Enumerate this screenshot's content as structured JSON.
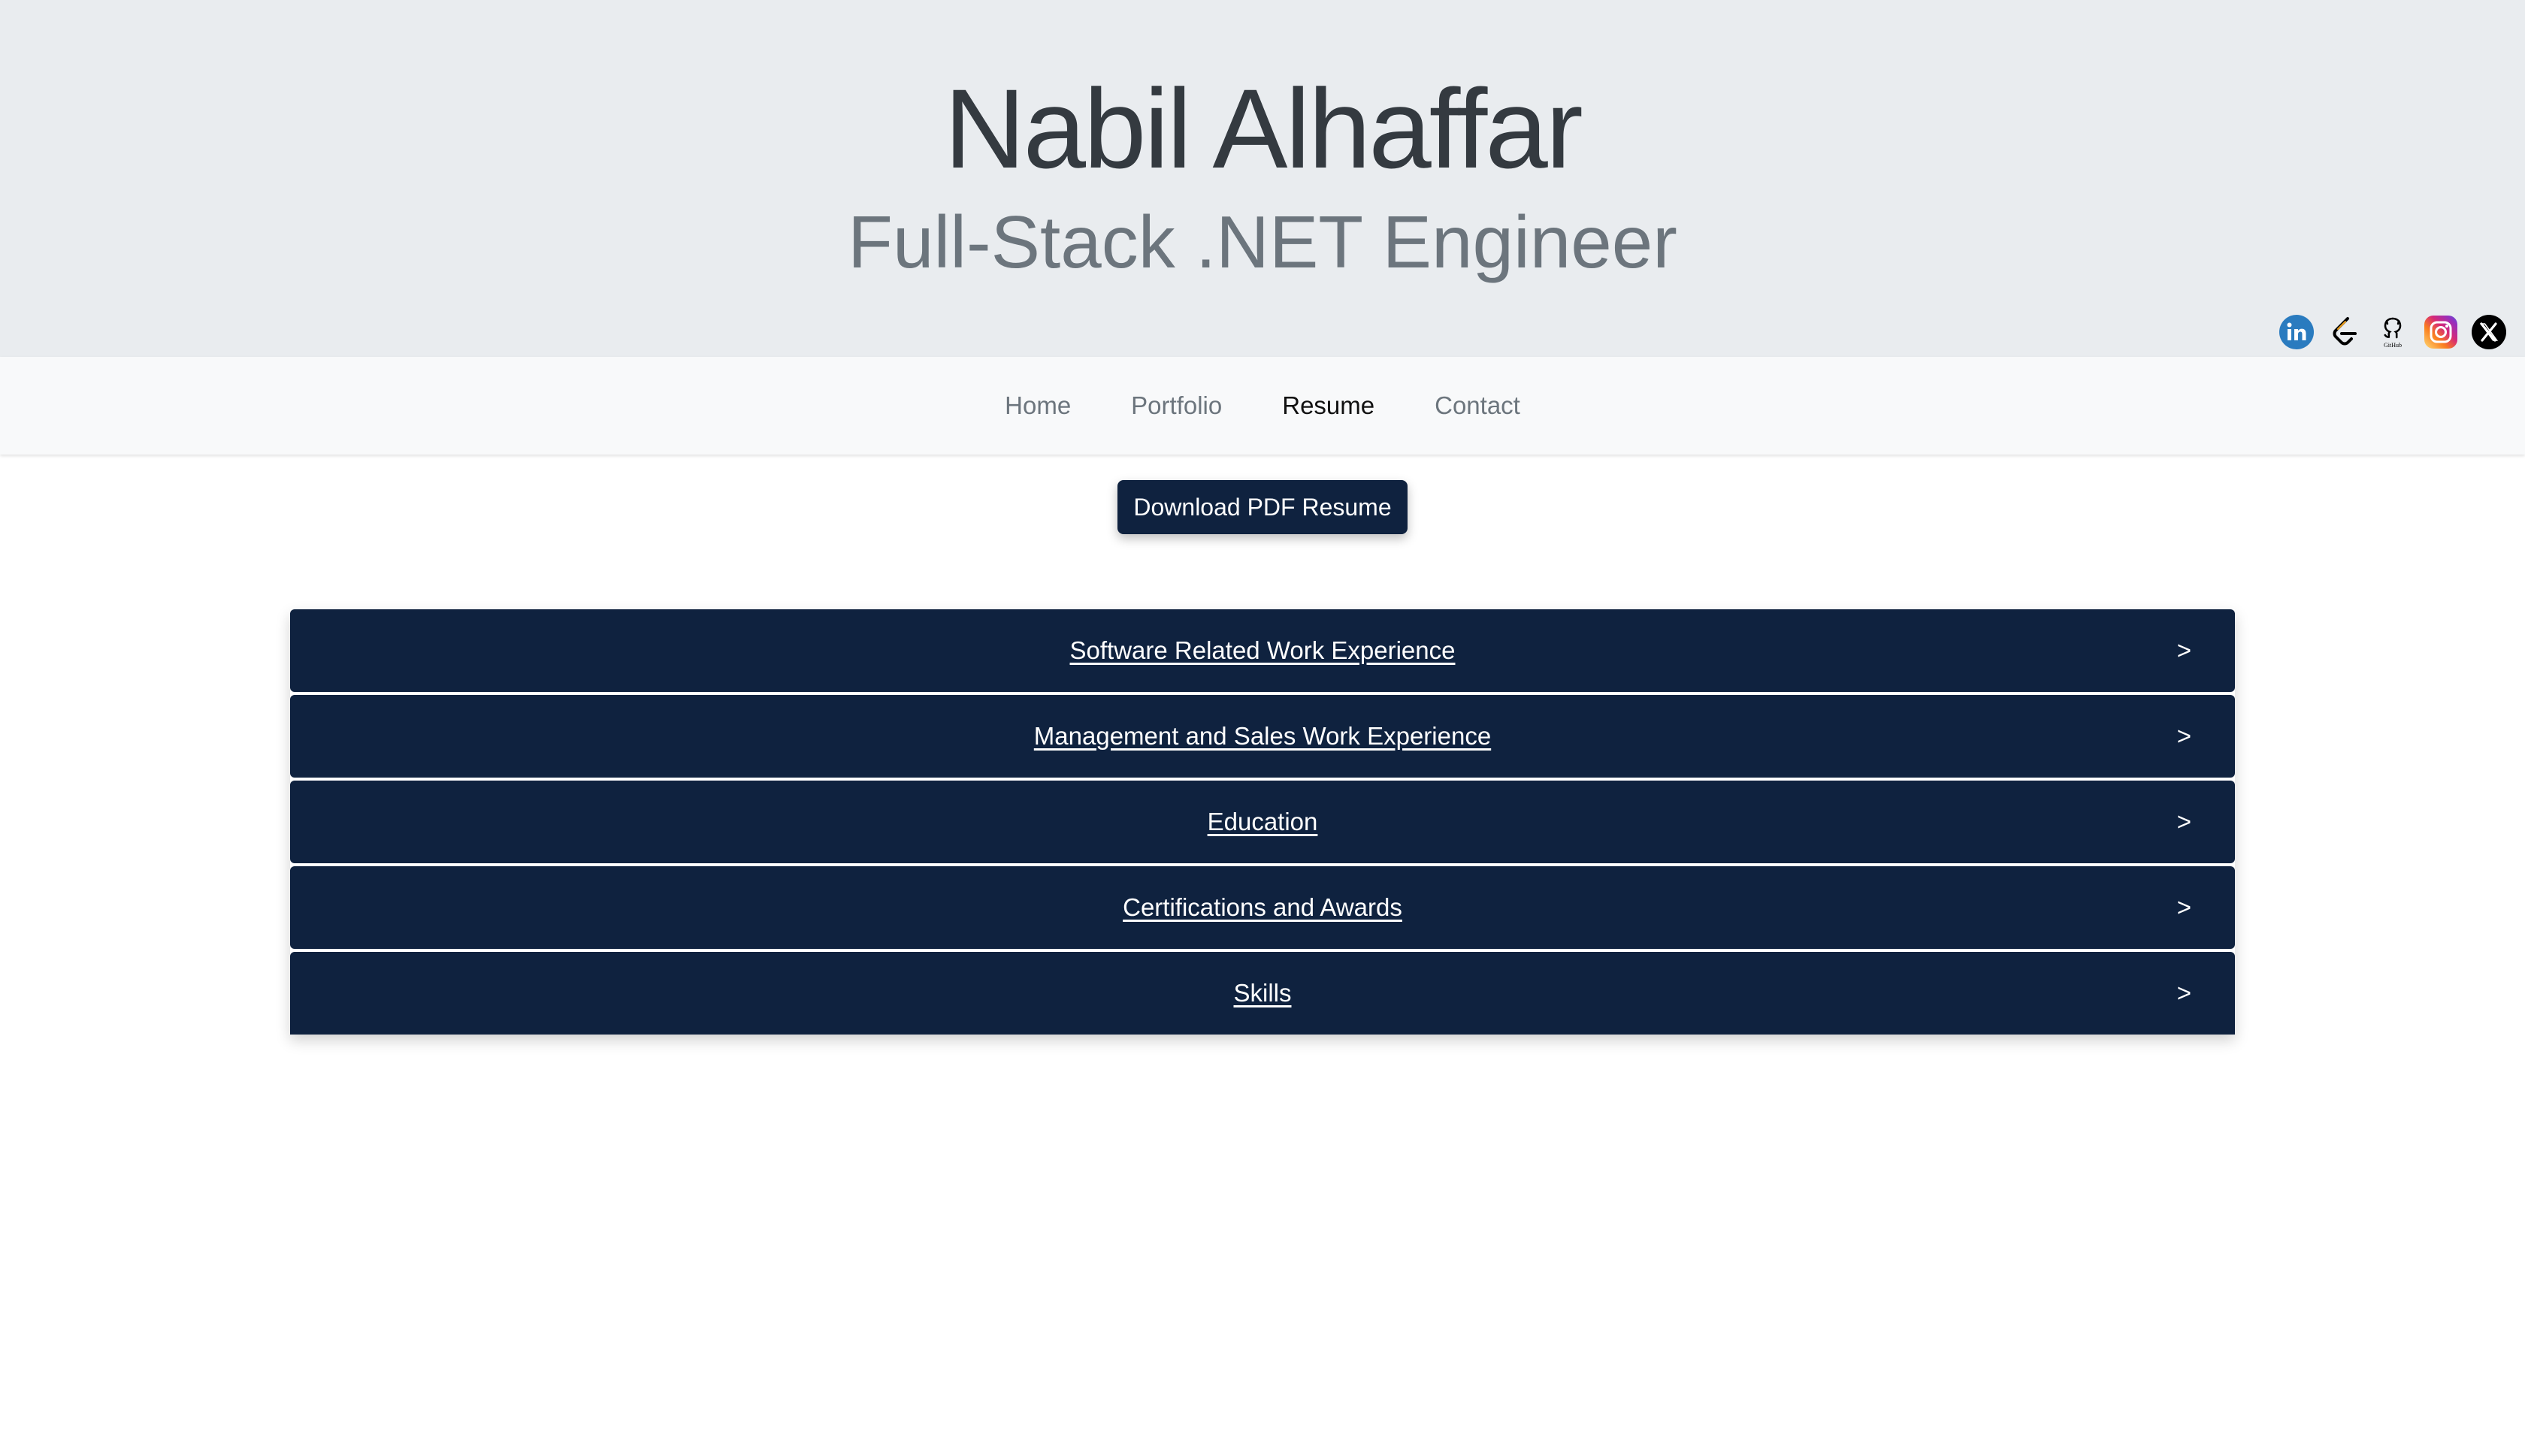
{
  "header": {
    "name": "Nabil Alhaffar",
    "title": "Full-Stack .NET Engineer",
    "social": [
      {
        "icon": "linkedin-icon",
        "color": "#2a7bbf"
      },
      {
        "icon": "leetcode-icon",
        "color": "#000000"
      },
      {
        "icon": "github-icon",
        "color": "#000000"
      },
      {
        "icon": "instagram-icon",
        "color": "#c13584"
      },
      {
        "icon": "x-icon",
        "color": "#000000"
      }
    ]
  },
  "nav": {
    "items": [
      {
        "label": "Home"
      },
      {
        "label": "Portfolio"
      },
      {
        "label": "Resume",
        "active": true
      },
      {
        "label": "Contact"
      }
    ]
  },
  "download": {
    "label": "Download PDF Resume"
  },
  "accordion": {
    "chevron": ">",
    "sections": [
      {
        "label": "Software Related Work Experience"
      },
      {
        "label": "Management and Sales Work Experience"
      },
      {
        "label": "Education"
      },
      {
        "label": "Certifications and Awards"
      },
      {
        "label": "Skills"
      }
    ]
  },
  "colors": {
    "header_bg": "#e9ecef",
    "nav_bg": "#f8f9fa",
    "primary": "#0f223f"
  }
}
